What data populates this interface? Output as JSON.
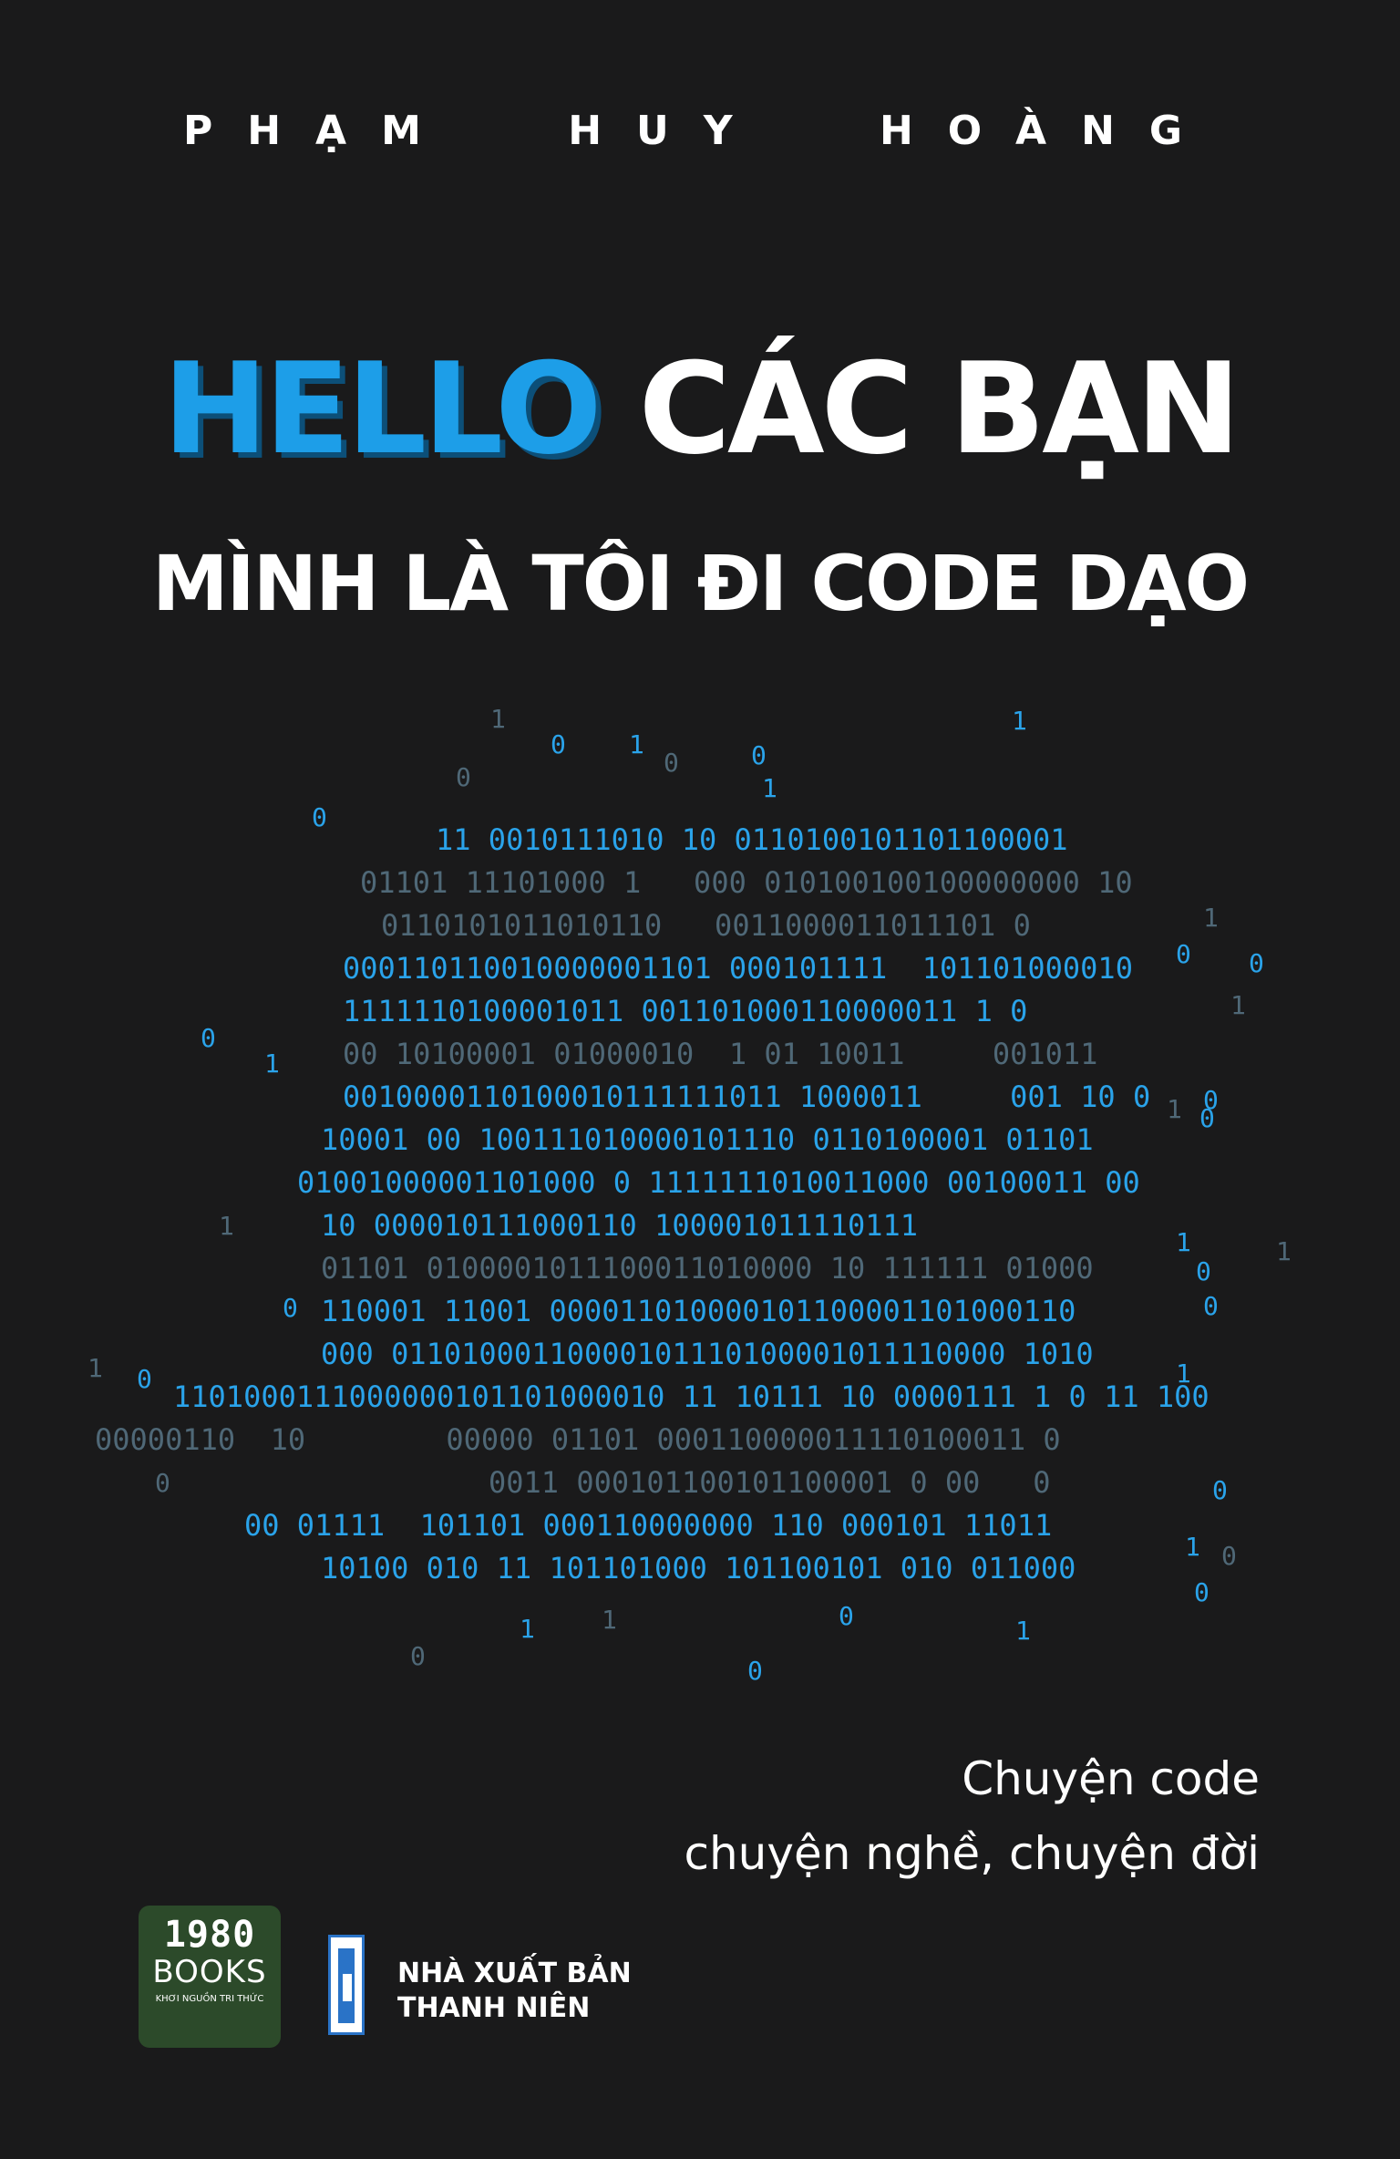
{
  "cover": {
    "author": [
      "PHẠM",
      "HUY",
      "HOÀNG"
    ],
    "title_highlight": "HELLO",
    "title_rest": "CÁC BẠN",
    "subtitle": "MÌNH LÀ TÔI ĐI CODE DẠO",
    "tagline_line1": "Chuyện code",
    "tagline_line2": "chuyện nghề, chuyện đời",
    "brand_1980": "1980",
    "brand_books": "BOOKS",
    "brand_motto": "KHƠI NGUỒN TRI THỨC",
    "publisher_line1": "NHÀ XUẤT BẢN",
    "publisher_line2": "THANH NIÊN"
  },
  "binary_art": {
    "colors": {
      "bright": "#2aa3ea",
      "dim": "#4f6877"
    },
    "rows": [
      {
        "text": "11 0010111010 10 0110100101101100001",
        "tone": "bright"
      },
      {
        "text": "01101 11101000 1   000 010100100100000000 10",
        "tone": "dim"
      },
      {
        "text": "0110101011010110   0011000011011101 0",
        "tone": "dim"
      },
      {
        "text": "000110110010000001101 000101111  101101000010",
        "tone": "bright"
      },
      {
        "text": "1111110100001011 001101000110000011 1 0",
        "tone": "bright"
      },
      {
        "text": "00 10100001 01000010  1 01 10011     001011",
        "tone": "dim"
      },
      {
        "text": "0010000110100010111111011 1000011     001 10 0",
        "tone": "bright"
      },
      {
        "text": "10001 00 100111010000101110 0110100001 01101",
        "tone": "bright"
      },
      {
        "text": "01001000001101000 0 1111111010011000 00100011 00",
        "tone": "bright"
      },
      {
        "text": "10 000010111000110 100001011110111",
        "tone": "bright"
      },
      {
        "text": "01101 0100001011100011010000 10 111111 01000",
        "tone": "dim"
      },
      {
        "text": "110001 11001 000011010000101100001101000110",
        "tone": "bright"
      },
      {
        "text": "000 01101000110000101110100001011110000 1010",
        "tone": "bright"
      },
      {
        "text": "1101000111000000101101000010 11 10111 10 0000111 1 0 11 100",
        "tone": "bright"
      },
      {
        "text": "00000110  10        00000 01101 000110000011110100011 0",
        "tone": "dim"
      },
      {
        "text": "0011 000101100101100001 0 00   0",
        "tone": "dim"
      },
      {
        "text": "00 01111  101101 000110000000 110 000101 11011",
        "tone": "bright"
      },
      {
        "text": "10100 010 11 101101000 101100101 010 011000",
        "tone": "bright"
      }
    ],
    "scatter": [
      "1",
      "0",
      "1",
      "0",
      "0",
      "1",
      "0",
      "1",
      "0",
      "1",
      "0",
      "0",
      "1",
      "0",
      "1",
      "1",
      "0",
      "0",
      "1",
      "1",
      "0",
      "1",
      "0",
      "0",
      "1",
      "0",
      "1",
      "0",
      "0",
      "1",
      "0",
      "0",
      "1",
      "1",
      "0",
      "1",
      "0",
      "0"
    ]
  }
}
